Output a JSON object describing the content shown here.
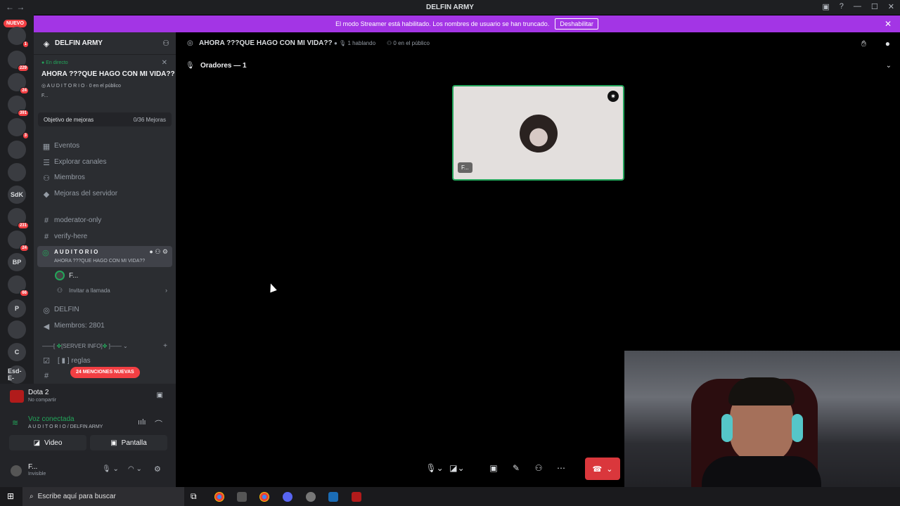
{
  "window": {
    "title": "DELFIN ARMY"
  },
  "banner": {
    "text": "El modo Streamer está habilitado. Los nombres de usuario se han truncado.",
    "button": "Deshabilitar"
  },
  "rail": {
    "nuevo": "NUEVO",
    "items": [
      {
        "label": "",
        "badge": "1"
      },
      {
        "label": "",
        "badge": "229"
      },
      {
        "label": "",
        "badge": "24"
      },
      {
        "label": "",
        "badge": "391"
      },
      {
        "label": "",
        "badge": "3"
      },
      {
        "label": "",
        "badge": ""
      },
      {
        "label": "",
        "badge": ""
      },
      {
        "label": "SdK",
        "badge": ""
      },
      {
        "label": "",
        "badge": "231"
      },
      {
        "label": "",
        "badge": "24"
      },
      {
        "label": "BP",
        "badge": ""
      },
      {
        "label": "",
        "badge": "66"
      },
      {
        "label": "P",
        "badge": ""
      },
      {
        "label": "",
        "badge": ""
      },
      {
        "label": "C",
        "badge": ""
      },
      {
        "label": "Esd-E-",
        "badge": ""
      }
    ]
  },
  "sidebar": {
    "server_name": "DELFIN ARMY",
    "live": {
      "status": "En directo",
      "title": "AHORA ???QUE HAGO CON MI VIDA??",
      "channel": "A U D I T O R I O",
      "audience": "0 en el público",
      "member": "F..."
    },
    "goal": {
      "label": "Objetivo de mejoras",
      "value": "0/36 Mejoras"
    },
    "nav": [
      {
        "label": "Eventos"
      },
      {
        "label": "Explorar canales"
      },
      {
        "label": "Miembros"
      },
      {
        "label": "Mejoras del servidor"
      }
    ],
    "channels": [
      {
        "label": "moderator-only"
      },
      {
        "label": "verify-here"
      }
    ],
    "voice": {
      "name": "A U D I T O R I O",
      "topic": "AHORA ???QUE HAGO CON MI VIDA??",
      "member": "F...",
      "invite": "Invitar a llamada"
    },
    "extra": [
      {
        "label": "DELFIN"
      },
      {
        "label": "Miembros: 2801"
      }
    ],
    "category": "[SERVER INFO]",
    "rules": "reglas",
    "mentions": "24 MENCIONES NUEVAS"
  },
  "panel": {
    "activity": {
      "game": "Dota 2",
      "status": "No compartir"
    },
    "voice": {
      "status": "Voz conectada",
      "location": "A U D I T O R I O / DELFIN ARMY"
    },
    "video_label": "Video",
    "screen_label": "Pantalla",
    "user": {
      "name": "F...",
      "status": "Invisible"
    }
  },
  "main": {
    "channel_title": "AHORA ???QUE HAGO CON MI VIDA??",
    "speaking": "1 hablando",
    "audience": "0 en el público",
    "speakers_header": "Oradores — 1",
    "tile_name": "F..."
  },
  "taskbar": {
    "search_placeholder": "Escribe aquí para buscar"
  },
  "colors": {
    "accent_banner": "#a335e5",
    "live_green": "#23a55a",
    "hangup_red": "#da373c",
    "mention_red": "#f23f43"
  }
}
